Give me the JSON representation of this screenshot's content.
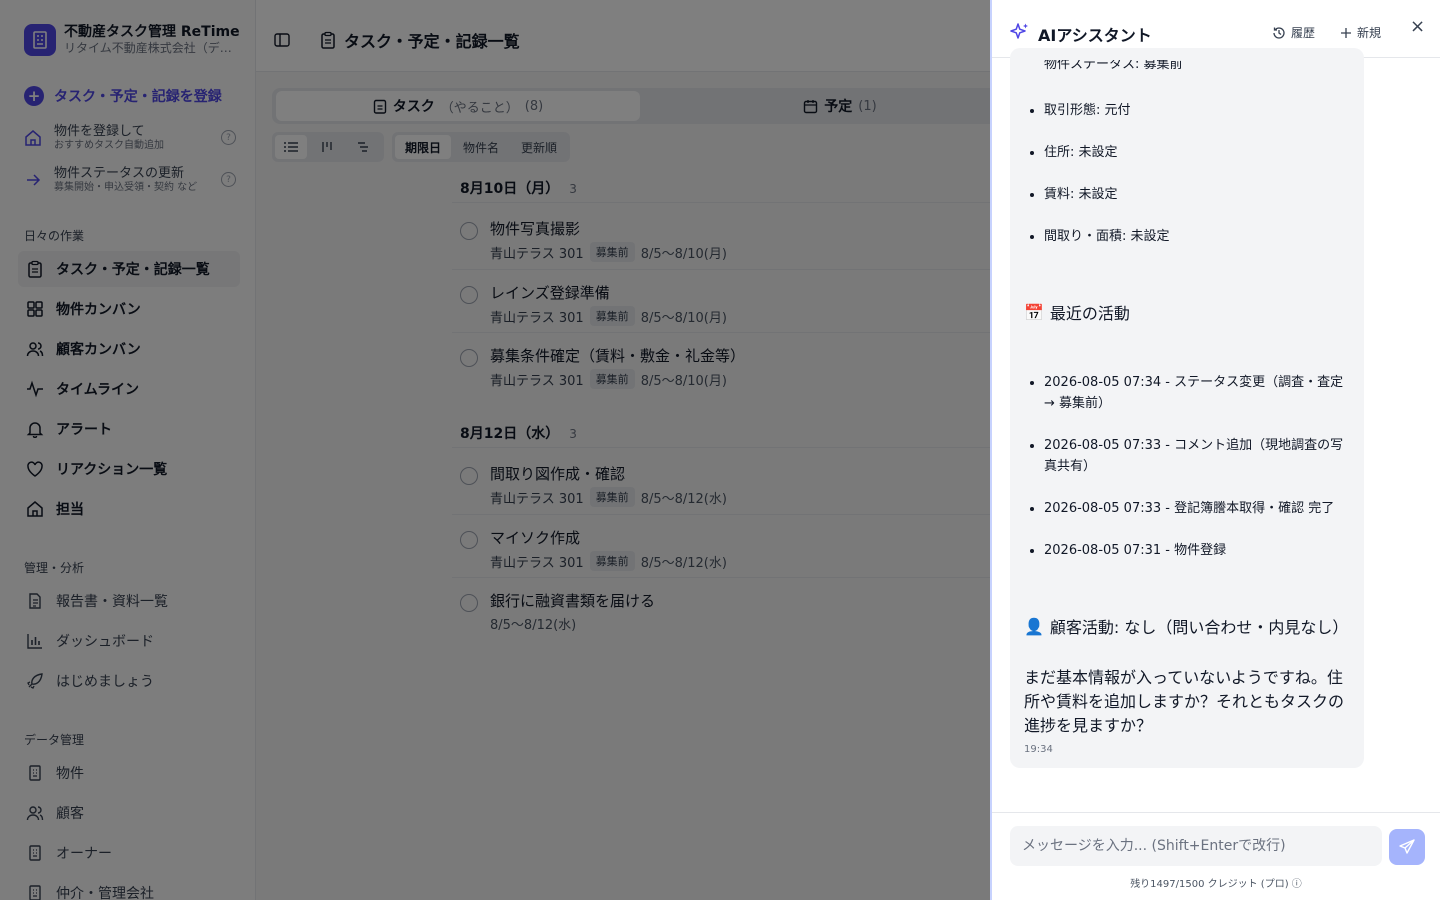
{
  "brand": {
    "name": "不動産タスク管理 ReTime",
    "company": "リタイム不動産株式会社（デモ）"
  },
  "sidebar": {
    "register_label": "タスク・予定・記録を登録",
    "quick": [
      {
        "title": "物件を登録して",
        "sub": "おすすめタスク自動追加"
      },
      {
        "title": "物件ステータスの更新",
        "sub": "募集開始・申込受領・契約 など"
      }
    ],
    "section_daily": "日々の作業",
    "daily": [
      {
        "label": "タスク・予定・記録一覧",
        "icon": "clipboard-icon"
      },
      {
        "label": "物件カンバン",
        "icon": "grid-icon"
      },
      {
        "label": "顧客カンバン",
        "icon": "users-icon"
      },
      {
        "label": "タイムライン",
        "icon": "activity-icon"
      },
      {
        "label": "アラート",
        "icon": "bell-icon"
      },
      {
        "label": "リアクション一覧",
        "icon": "heart-icon"
      },
      {
        "label": "担当",
        "icon": "home-icon"
      }
    ],
    "section_mgmt": "管理・分析",
    "mgmt": [
      {
        "label": "報告書・資料一覧",
        "icon": "document-icon"
      },
      {
        "label": "ダッシュボード",
        "icon": "bar-chart-icon"
      },
      {
        "label": "はじめましょう",
        "icon": "rocket-icon"
      }
    ],
    "section_data": "データ管理",
    "data": [
      {
        "label": "物件",
        "icon": "building-icon"
      },
      {
        "label": "顧客",
        "icon": "users-icon"
      },
      {
        "label": "オーナー",
        "icon": "building-icon"
      },
      {
        "label": "仲介・管理会社",
        "icon": "building-icon"
      }
    ]
  },
  "header": {
    "title": "タスク・予定・記録一覧"
  },
  "tabs": [
    {
      "label": "タスク",
      "note": "（やること）",
      "count": "(8)"
    },
    {
      "label": "予定",
      "count": "(1)"
    }
  ],
  "sort": [
    "期限日",
    "物件名",
    "更新順"
  ],
  "groups": [
    {
      "date": "8月10日（月）",
      "count": "3",
      "tasks": [
        {
          "title": "物件写真撮影",
          "property": "青山テラス 301",
          "badge": "募集前",
          "date": "8/5〜8/10(月)"
        },
        {
          "title": "レインズ登録準備",
          "property": "青山テラス 301",
          "badge": "募集前",
          "date": "8/5〜8/10(月)"
        },
        {
          "title": "募集条件確定（賃料・敷金・礼金等）",
          "property": "青山テラス 301",
          "badge": "募集前",
          "date": "8/5〜8/10(月)"
        }
      ]
    },
    {
      "date": "8月12日（水）",
      "count": "3",
      "tasks": [
        {
          "title": "間取り図作成・確認",
          "property": "青山テラス 301",
          "badge": "募集前",
          "date": "8/5〜8/12(水)"
        },
        {
          "title": "マイソク作成",
          "property": "青山テラス 301",
          "badge": "募集前",
          "date": "8/5〜8/12(水)"
        },
        {
          "title": "銀行に融資書類を届ける",
          "property": "",
          "badge": "",
          "date": "8/5〜8/12(水)"
        }
      ]
    }
  ],
  "assistant": {
    "title": "AIアシスタント",
    "history_label": "履歴",
    "new_label": "新規",
    "close_label": "×",
    "cut_line": "物件ステータス: 募集前",
    "info": [
      "取引形態: 元付",
      "住所: 未設定",
      "賃料: 未設定",
      "間取り・面積: 未設定"
    ],
    "activity_heading": "最近の活動",
    "activity_emoji": "📅",
    "activities": [
      "2026-08-05 07:34 - ステータス変更（調査・査定 → 募集前）",
      "2026-08-05 07:33 - コメント追加（現地調査の写真共有）",
      "2026-08-05 07:33 - 登記簿謄本取得・確認 完了",
      "2026-08-05 07:31 - 物件登録"
    ],
    "customer_emoji": "👤",
    "customer_line": "顧客活動: なし（問い合わせ・内見なし）",
    "closing": "まだ基本情報が入っていないようですね。住所や賃料を追加しますか？それともタスクの進捗を見ますか？",
    "time": "19:34",
    "input_placeholder": "メッセージを入力... (Shift+Enterで改行)",
    "credits": "残り1497/1500 クレジット (プロ) ⓘ"
  },
  "colors": {
    "accent": "#4f46e5",
    "send": "#a5b4fc",
    "overlay": "rgba(0,0,0,0.5)"
  }
}
